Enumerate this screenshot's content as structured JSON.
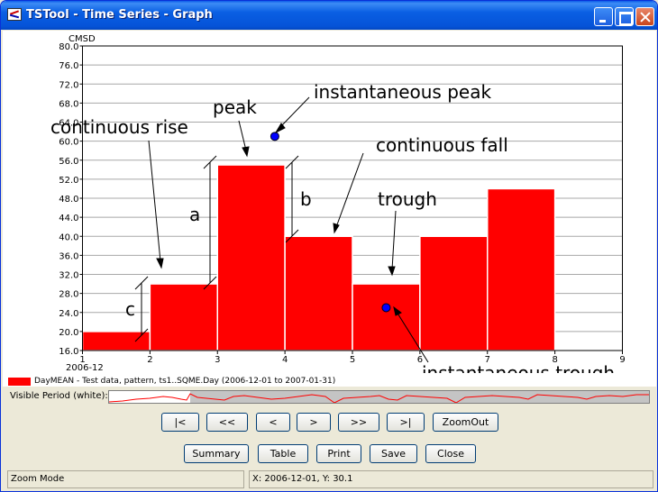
{
  "window": {
    "title": "TSTool - Time Series - Graph"
  },
  "chart_data": {
    "type": "bar",
    "ylabel": "CMSD",
    "ylim": [
      16.0,
      80.0
    ],
    "y_ticks": [
      "80.0",
      "76.0",
      "72.0",
      "68.0",
      "64.0",
      "60.0",
      "56.0",
      "52.0",
      "48.0",
      "44.0",
      "40.0",
      "36.0",
      "32.0",
      "28.0",
      "24.0",
      "20.0",
      "16.0"
    ],
    "x_ticks": [
      "1",
      "2",
      "3",
      "4",
      "5",
      "6",
      "7",
      "8",
      "9"
    ],
    "xlim": [
      1,
      9
    ],
    "x_start_label": "2006-12",
    "grid": true,
    "bars": [
      {
        "x_start": 1,
        "x_end": 2,
        "value": 20.0
      },
      {
        "x_start": 2,
        "x_end": 3,
        "value": 30.0
      },
      {
        "x_start": 3,
        "x_end": 4,
        "value": 55.0
      },
      {
        "x_start": 4,
        "x_end": 5,
        "value": 40.0
      },
      {
        "x_start": 5,
        "x_end": 6,
        "value": 30.0
      },
      {
        "x_start": 6,
        "x_end": 7,
        "value": 40.0
      },
      {
        "x_start": 7,
        "x_end": 8,
        "value": 50.0
      }
    ],
    "points": [
      {
        "x": 3.85,
        "value": 61.0,
        "color": "#0000ff"
      },
      {
        "x": 5.5,
        "value": 25.0,
        "color": "#0000ff"
      }
    ],
    "bar_color": "#ff0000",
    "annotations": {
      "instantaneous_peak": "instantaneous peak",
      "peak": "peak",
      "continuous_rise": "continuous rise",
      "continuous_fall": "continuous fall",
      "a": "a",
      "b": "b",
      "c": "c",
      "trough": "trough",
      "instantaneous_trough": "instantaneous trough"
    }
  },
  "legend": {
    "text": "DayMEAN - Test data, pattern, ts1..SQME.Day (2006-12-01 to 2007-01-31)",
    "color": "#ff0000"
  },
  "visible_period": {
    "label": "Visible Period (white):",
    "visible_fraction": 0.15
  },
  "nav_buttons": {
    "first": "|<",
    "page_back": "<<",
    "back": "<",
    "forward": ">",
    "page_forward": ">>",
    "last": ">|",
    "zoom_out": "ZoomOut"
  },
  "action_buttons": {
    "summary": "Summary",
    "table": "Table",
    "print": "Print",
    "save": "Save",
    "close": "Close"
  },
  "status": {
    "mode": "Zoom Mode",
    "coords": "X:  2006-12-01,  Y:  30.1"
  }
}
